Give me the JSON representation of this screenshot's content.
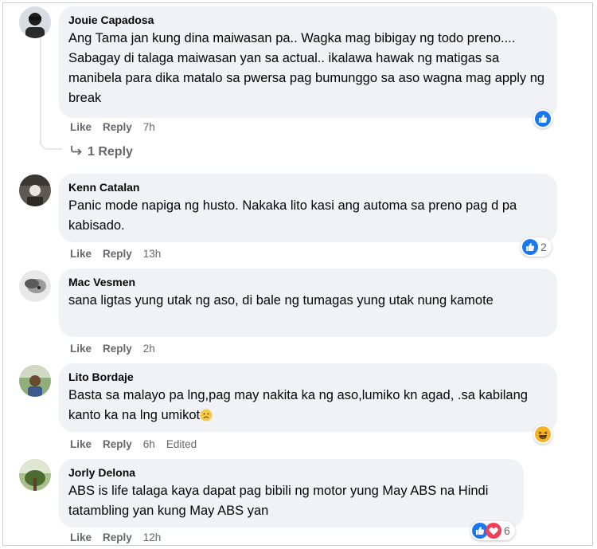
{
  "comments": [
    {
      "author": "Jouie Capadosa",
      "text": "Ang Tama jan kung dina maiwasan pa.. Wagka mag bibigay ng todo preno.... Sabagay di talaga maiwasan yan sa actual.. ikalawa hawak ng matigas sa manibela para dika matalo sa pwersa pag bumunggo sa aso wagna mag apply ng break",
      "like": "Like",
      "reply": "Reply",
      "time": "7h",
      "reaction_count": "",
      "reactions": [
        "like-icon"
      ]
    },
    {
      "author": "Kenn Catalan",
      "text": "Panic mode napiga ng husto. Nakaka lito kasi ang automa sa preno pag d pa kabisado.",
      "like": "Like",
      "reply": "Reply",
      "time": "13h",
      "reaction_count": "2",
      "reactions": [
        "like-icon"
      ]
    },
    {
      "author": "Mac Vesmen",
      "text": "sana ligtas yung utak ng aso, di bale ng tumagas yung utak nung kamote",
      "like": "Like",
      "reply": "Reply",
      "time": "2h"
    },
    {
      "author": "Lito Bordaje",
      "text": "Basta sa malayo pa lng,pag may nakita ka ng aso,lumiko kn agad, .sa kabilang kanto ka na lng umikot",
      "like": "Like",
      "reply": "Reply",
      "time": "6h",
      "edited": "Edited",
      "reactions": [
        "haha-icon"
      ]
    },
    {
      "author": "Jorly Delona",
      "text": "ABS is life talaga kaya dapat pag bibili ng motor yung May ABS na Hindi tatambling yan kung May ABS yan",
      "like": "Like",
      "reply": "Reply",
      "time": "12h",
      "reaction_count": "6",
      "reactions": [
        "like-icon",
        "love-icon"
      ]
    }
  ],
  "replies_link": "1 Reply",
  "colors": {
    "bubble": "#f0f2f5",
    "like_blue": "#1877f2",
    "love_red": "#f33e58",
    "meta_gray": "#65676b"
  }
}
